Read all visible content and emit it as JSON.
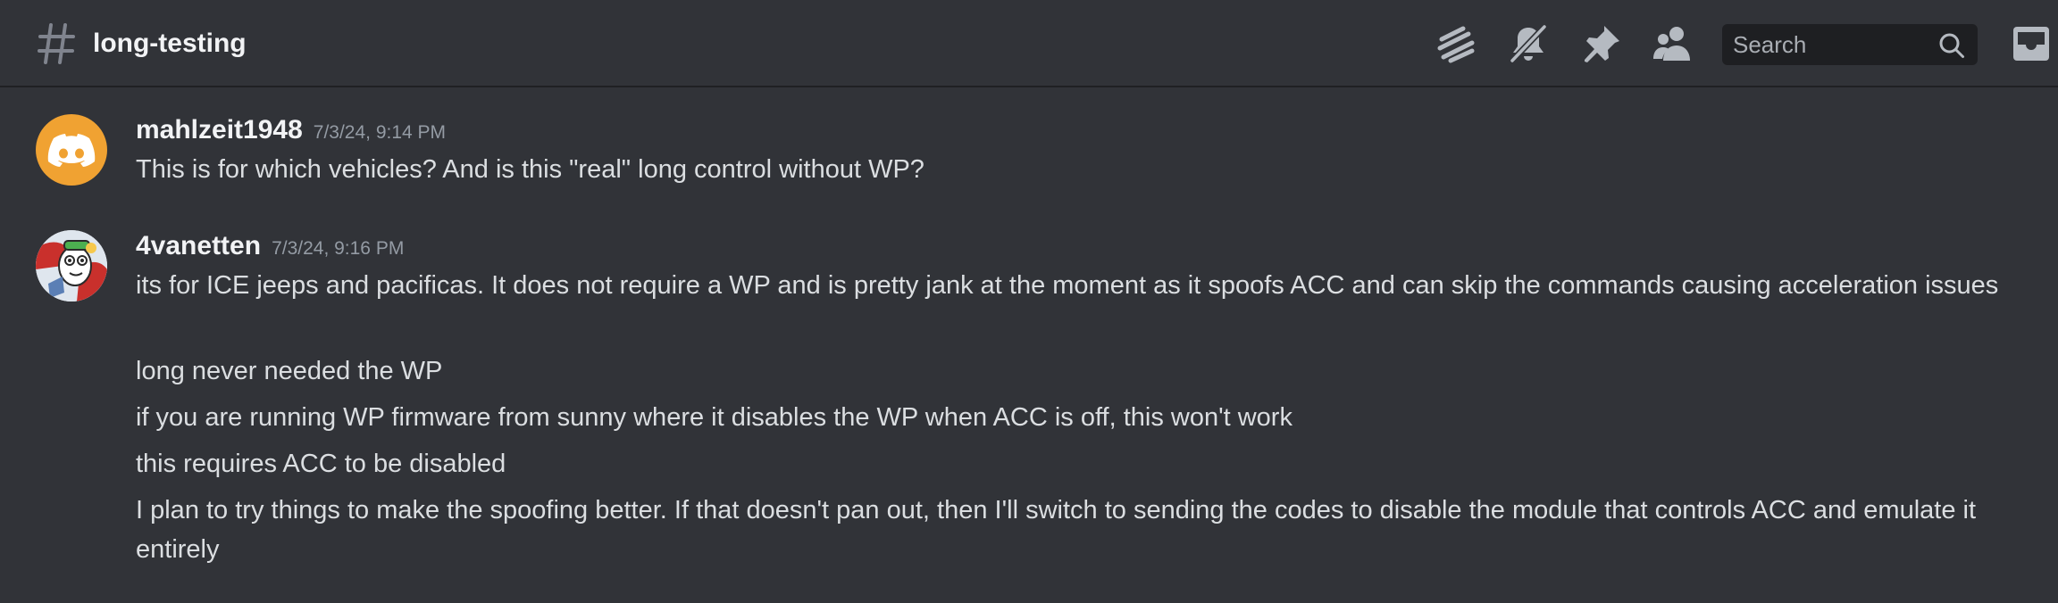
{
  "channel": {
    "name": "long-testing"
  },
  "header": {
    "search_placeholder": "Search",
    "icons": [
      "threads-icon",
      "mute-bell-icon",
      "pin-icon",
      "members-icon",
      "search-icon",
      "inbox-icon"
    ]
  },
  "messages": [
    {
      "author": "mahlzeit1948",
      "timestamp": "7/3/24, 9:14 PM",
      "avatar": "discord-logo-avatar",
      "lines": [
        "This is for which vehicles? And is this \"real\" long control without WP?"
      ]
    },
    {
      "author": "4vanetten",
      "timestamp": "7/3/24, 9:16 PM",
      "avatar": "cartoon-character-avatar",
      "lines": [
        "its for ICE jeeps and pacificas.  It does not require a WP and is pretty jank at the moment as it spoofs ACC and can skip the commands causing acceleration issues",
        "long never needed the WP",
        "if you are running WP firmware from sunny where it disables the WP when ACC is off, this won't work",
        "this requires ACC to be disabled",
        "I plan to try things to make the spoofing better.  If that doesn't pan out, then I'll switch to sending the codes to disable the module that controls ACC and emulate it entirely"
      ]
    }
  ],
  "colors": {
    "background": "#313338",
    "avatar_orange": "#f0a232",
    "timestamp": "#949ba4"
  }
}
